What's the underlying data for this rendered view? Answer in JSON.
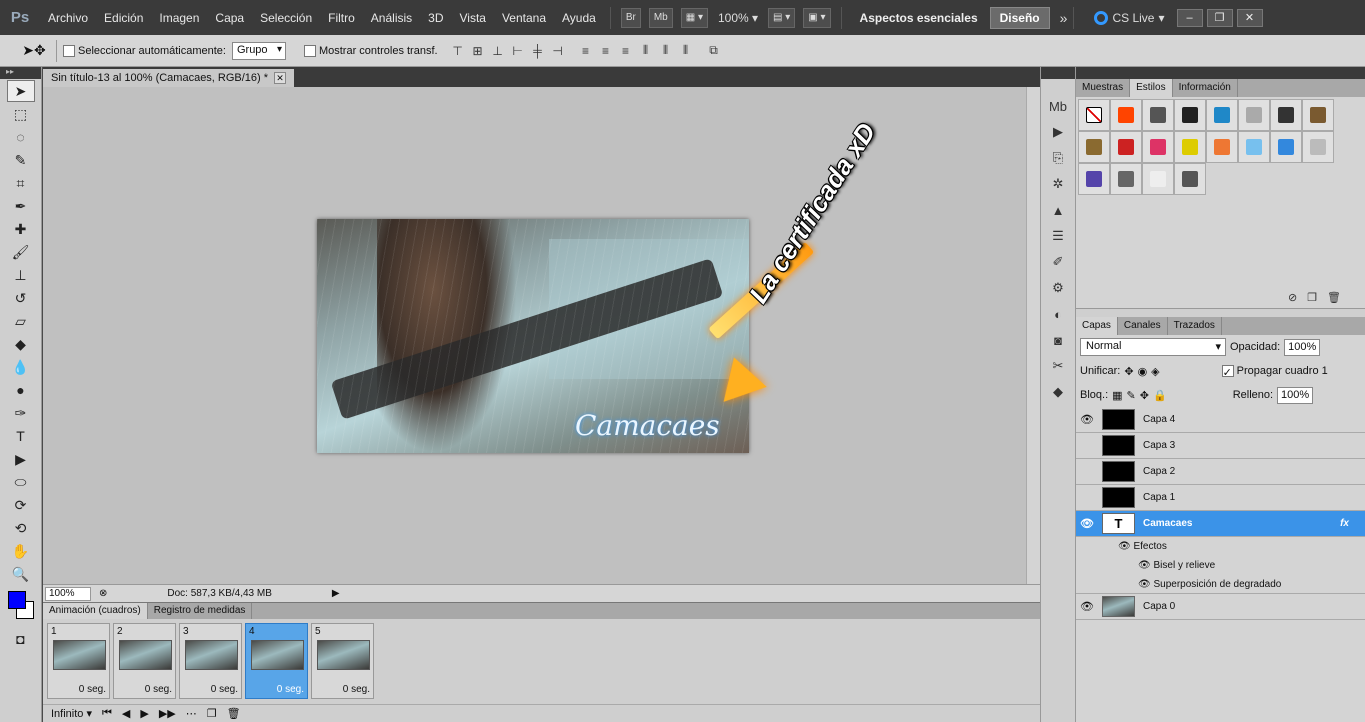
{
  "menubar": {
    "logo": "Ps",
    "items": [
      "Archivo",
      "Edición",
      "Imagen",
      "Capa",
      "Selección",
      "Filtro",
      "Análisis",
      "3D",
      "Vista",
      "Ventana",
      "Ayuda"
    ],
    "br": "Br",
    "mb": "Mb",
    "zoom": "100%",
    "workspace": "Aspectos esenciales",
    "design": "Diseño",
    "more": "»",
    "cslive": "CS Live"
  },
  "options": {
    "auto_select_label": "Seleccionar automáticamente:",
    "group_select": "Grupo",
    "transform_label": "Mostrar controles transf."
  },
  "document": {
    "tab_title": "Sin título-13 al 100% (Camacaes, RGB/16) *",
    "image_signature": "Camacaes",
    "annotation": "La certificada xD",
    "zoom": "100%",
    "doc_info": "Doc: 587,3 KB/4,43 MB"
  },
  "animation": {
    "tabs": [
      "Animación (cuadros)",
      "Registro de medidas"
    ],
    "frames": [
      {
        "num": "1",
        "delay": "0 seg."
      },
      {
        "num": "2",
        "delay": "0 seg."
      },
      {
        "num": "3",
        "delay": "0 seg."
      },
      {
        "num": "4",
        "delay": "0 seg."
      },
      {
        "num": "5",
        "delay": "0 seg."
      }
    ],
    "loop": "Infinito"
  },
  "styles_panel": {
    "tabs": [
      "Muestras",
      "Estilos",
      "Información"
    ],
    "swatch_colors": [
      "none",
      "#ff4400",
      "#555555",
      "#222222",
      "#1f88c8",
      "#aaaaaa",
      "#333333",
      "#7a5a30",
      "#8a6a30",
      "#cc2222",
      "#dd3366",
      "#ddcc00",
      "#ee7733",
      "#77c0ee",
      "#3388dd",
      "#bbbbbb",
      "#5544aa",
      "#666666",
      "#eeeeee",
      "#555555"
    ]
  },
  "layers_panel": {
    "tabs": [
      "Capas",
      "Canales",
      "Trazados"
    ],
    "blend_mode": "Normal",
    "opacity_label": "Opacidad:",
    "opacity": "100%",
    "unify_label": "Unificar:",
    "propagate_label": "Propagar cuadro 1",
    "lock_label": "Bloq.:",
    "fill_label": "Relleno:",
    "fill": "100%",
    "layers": [
      "Capa 4",
      "Capa 3",
      "Capa 2",
      "Capa 1",
      "Camacaes",
      "Capa 0"
    ],
    "effects_label": "Efectos",
    "effects": [
      "Bisel y relieve",
      "Superposición de degradado"
    ],
    "fx": "fx",
    "text_thumb": "T"
  }
}
